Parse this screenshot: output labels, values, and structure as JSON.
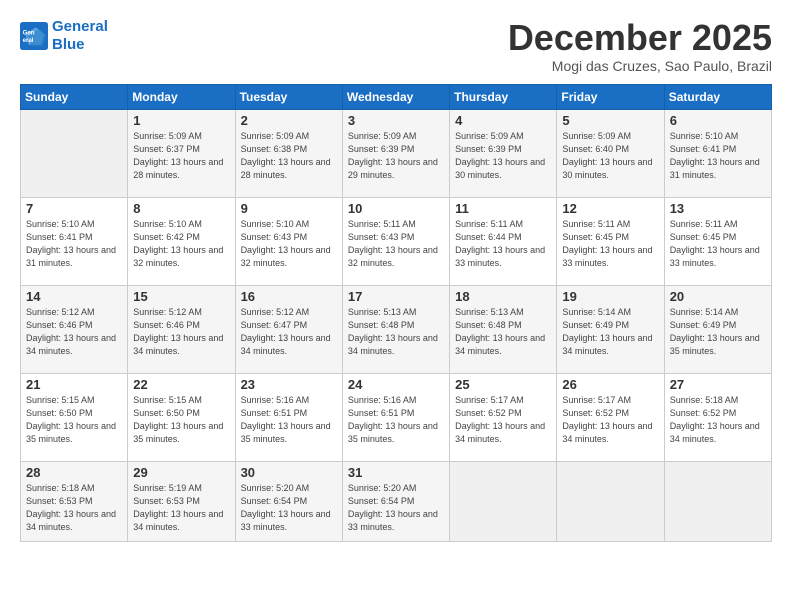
{
  "logo": {
    "line1": "General",
    "line2": "Blue"
  },
  "header": {
    "month": "December 2025",
    "location": "Mogi das Cruzes, Sao Paulo, Brazil"
  },
  "weekdays": [
    "Sunday",
    "Monday",
    "Tuesday",
    "Wednesday",
    "Thursday",
    "Friday",
    "Saturday"
  ],
  "weeks": [
    [
      {
        "day": "",
        "empty": true
      },
      {
        "day": "1",
        "sunrise": "Sunrise: 5:09 AM",
        "sunset": "Sunset: 6:37 PM",
        "daylight": "Daylight: 13 hours and 28 minutes."
      },
      {
        "day": "2",
        "sunrise": "Sunrise: 5:09 AM",
        "sunset": "Sunset: 6:38 PM",
        "daylight": "Daylight: 13 hours and 28 minutes."
      },
      {
        "day": "3",
        "sunrise": "Sunrise: 5:09 AM",
        "sunset": "Sunset: 6:39 PM",
        "daylight": "Daylight: 13 hours and 29 minutes."
      },
      {
        "day": "4",
        "sunrise": "Sunrise: 5:09 AM",
        "sunset": "Sunset: 6:39 PM",
        "daylight": "Daylight: 13 hours and 30 minutes."
      },
      {
        "day": "5",
        "sunrise": "Sunrise: 5:09 AM",
        "sunset": "Sunset: 6:40 PM",
        "daylight": "Daylight: 13 hours and 30 minutes."
      },
      {
        "day": "6",
        "sunrise": "Sunrise: 5:10 AM",
        "sunset": "Sunset: 6:41 PM",
        "daylight": "Daylight: 13 hours and 31 minutes."
      }
    ],
    [
      {
        "day": "7",
        "sunrise": "Sunrise: 5:10 AM",
        "sunset": "Sunset: 6:41 PM",
        "daylight": "Daylight: 13 hours and 31 minutes."
      },
      {
        "day": "8",
        "sunrise": "Sunrise: 5:10 AM",
        "sunset": "Sunset: 6:42 PM",
        "daylight": "Daylight: 13 hours and 32 minutes."
      },
      {
        "day": "9",
        "sunrise": "Sunrise: 5:10 AM",
        "sunset": "Sunset: 6:43 PM",
        "daylight": "Daylight: 13 hours and 32 minutes."
      },
      {
        "day": "10",
        "sunrise": "Sunrise: 5:11 AM",
        "sunset": "Sunset: 6:43 PM",
        "daylight": "Daylight: 13 hours and 32 minutes."
      },
      {
        "day": "11",
        "sunrise": "Sunrise: 5:11 AM",
        "sunset": "Sunset: 6:44 PM",
        "daylight": "Daylight: 13 hours and 33 minutes."
      },
      {
        "day": "12",
        "sunrise": "Sunrise: 5:11 AM",
        "sunset": "Sunset: 6:45 PM",
        "daylight": "Daylight: 13 hours and 33 minutes."
      },
      {
        "day": "13",
        "sunrise": "Sunrise: 5:11 AM",
        "sunset": "Sunset: 6:45 PM",
        "daylight": "Daylight: 13 hours and 33 minutes."
      }
    ],
    [
      {
        "day": "14",
        "sunrise": "Sunrise: 5:12 AM",
        "sunset": "Sunset: 6:46 PM",
        "daylight": "Daylight: 13 hours and 34 minutes."
      },
      {
        "day": "15",
        "sunrise": "Sunrise: 5:12 AM",
        "sunset": "Sunset: 6:46 PM",
        "daylight": "Daylight: 13 hours and 34 minutes."
      },
      {
        "day": "16",
        "sunrise": "Sunrise: 5:12 AM",
        "sunset": "Sunset: 6:47 PM",
        "daylight": "Daylight: 13 hours and 34 minutes."
      },
      {
        "day": "17",
        "sunrise": "Sunrise: 5:13 AM",
        "sunset": "Sunset: 6:48 PM",
        "daylight": "Daylight: 13 hours and 34 minutes."
      },
      {
        "day": "18",
        "sunrise": "Sunrise: 5:13 AM",
        "sunset": "Sunset: 6:48 PM",
        "daylight": "Daylight: 13 hours and 34 minutes."
      },
      {
        "day": "19",
        "sunrise": "Sunrise: 5:14 AM",
        "sunset": "Sunset: 6:49 PM",
        "daylight": "Daylight: 13 hours and 34 minutes."
      },
      {
        "day": "20",
        "sunrise": "Sunrise: 5:14 AM",
        "sunset": "Sunset: 6:49 PM",
        "daylight": "Daylight: 13 hours and 35 minutes."
      }
    ],
    [
      {
        "day": "21",
        "sunrise": "Sunrise: 5:15 AM",
        "sunset": "Sunset: 6:50 PM",
        "daylight": "Daylight: 13 hours and 35 minutes."
      },
      {
        "day": "22",
        "sunrise": "Sunrise: 5:15 AM",
        "sunset": "Sunset: 6:50 PM",
        "daylight": "Daylight: 13 hours and 35 minutes."
      },
      {
        "day": "23",
        "sunrise": "Sunrise: 5:16 AM",
        "sunset": "Sunset: 6:51 PM",
        "daylight": "Daylight: 13 hours and 35 minutes."
      },
      {
        "day": "24",
        "sunrise": "Sunrise: 5:16 AM",
        "sunset": "Sunset: 6:51 PM",
        "daylight": "Daylight: 13 hours and 35 minutes."
      },
      {
        "day": "25",
        "sunrise": "Sunrise: 5:17 AM",
        "sunset": "Sunset: 6:52 PM",
        "daylight": "Daylight: 13 hours and 34 minutes."
      },
      {
        "day": "26",
        "sunrise": "Sunrise: 5:17 AM",
        "sunset": "Sunset: 6:52 PM",
        "daylight": "Daylight: 13 hours and 34 minutes."
      },
      {
        "day": "27",
        "sunrise": "Sunrise: 5:18 AM",
        "sunset": "Sunset: 6:52 PM",
        "daylight": "Daylight: 13 hours and 34 minutes."
      }
    ],
    [
      {
        "day": "28",
        "sunrise": "Sunrise: 5:18 AM",
        "sunset": "Sunset: 6:53 PM",
        "daylight": "Daylight: 13 hours and 34 minutes."
      },
      {
        "day": "29",
        "sunrise": "Sunrise: 5:19 AM",
        "sunset": "Sunset: 6:53 PM",
        "daylight": "Daylight: 13 hours and 34 minutes."
      },
      {
        "day": "30",
        "sunrise": "Sunrise: 5:20 AM",
        "sunset": "Sunset: 6:54 PM",
        "daylight": "Daylight: 13 hours and 33 minutes."
      },
      {
        "day": "31",
        "sunrise": "Sunrise: 5:20 AM",
        "sunset": "Sunset: 6:54 PM",
        "daylight": "Daylight: 13 hours and 33 minutes."
      },
      {
        "day": "",
        "empty": true
      },
      {
        "day": "",
        "empty": true
      },
      {
        "day": "",
        "empty": true
      }
    ]
  ]
}
